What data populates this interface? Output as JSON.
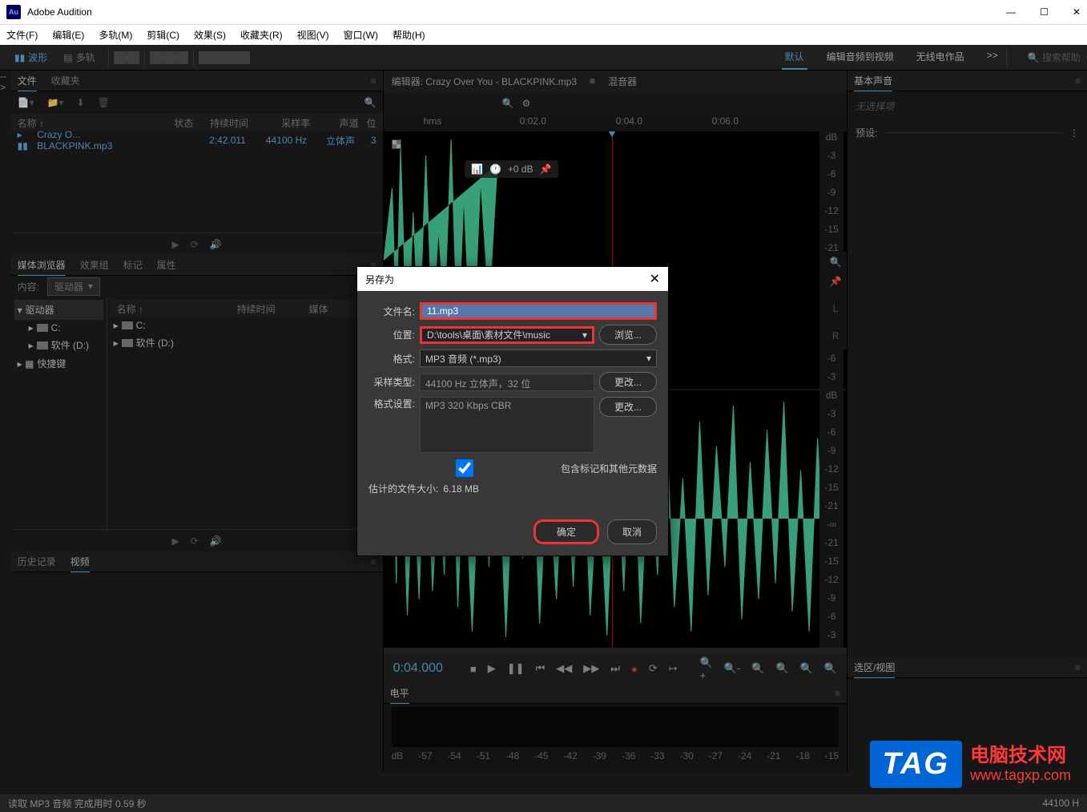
{
  "app": {
    "title": "Adobe Audition",
    "logo": "Au"
  },
  "menubar": [
    "文件(F)",
    "编辑(E)",
    "多轨(M)",
    "剪辑(C)",
    "效果(S)",
    "收藏夹(R)",
    "视图(V)",
    "窗口(W)",
    "帮助(H)"
  ],
  "toolbar": {
    "waveform": "波形",
    "multitrack": "多轨",
    "search_placeholder": "搜索帮助"
  },
  "workspaces": {
    "default": "默认",
    "edit_audio_video": "编辑音频到视频",
    "radio": "无线电作品",
    "more": ">>"
  },
  "panels": {
    "files_tab": "文件",
    "favorites_tab": "收藏夹",
    "media_browser_tab": "媒体浏览器",
    "effects_rack_tab": "效果组",
    "markers_tab": "标记",
    "properties_tab": "属性",
    "history_tab": "历史记录",
    "video_tab": "视频",
    "basic_sound_tab": "基本声音",
    "selection_view_tab": "选区/视图"
  },
  "file_panel": {
    "columns": {
      "name": "名称 ↑",
      "status": "状态",
      "duration": "持续时间",
      "sample_rate": "采样率",
      "channels": "声道",
      "bit": "位"
    },
    "row": {
      "name": "Crazy O... BLACKPINK.mp3",
      "duration": "2:42.011",
      "sample_rate": "44100 Hz",
      "channels": "立体声",
      "bit": "3"
    }
  },
  "media_browser": {
    "content_label": "内容:",
    "driver": "驱动器",
    "drives_header": "驱动器",
    "columns": {
      "name": "名称 ↑",
      "duration": "持续时间",
      "media": "媒体"
    },
    "items": [
      "C:",
      "软件 (D:)",
      "快捷键"
    ],
    "list_items": [
      "C:",
      "软件 (D:)"
    ]
  },
  "editor": {
    "title": "编辑器: Crazy Over You - BLACKPINK.mp3",
    "mixer": "混音器",
    "timeline": {
      "hms": "hms",
      "marks": [
        "0:02.0",
        "0:04.0",
        "0:06.0"
      ]
    },
    "db_label": "dB",
    "db_scale": [
      "-3",
      "-6",
      "-9",
      "-12",
      "-15",
      "-21",
      "-∞",
      "-21",
      "-15",
      "-12",
      "-9",
      "-6",
      "-3"
    ],
    "hud": "+0 dB",
    "stereo": {
      "l": "L",
      "r": "R"
    }
  },
  "transport": {
    "time": "0:04.000"
  },
  "levels": {
    "title": "电平",
    "scale": [
      "dB",
      "-57",
      "-54",
      "-51",
      "-48",
      "-45",
      "-42",
      "-39",
      "-36",
      "-33",
      "-30",
      "-27",
      "-24",
      "-21",
      "-18",
      "-15"
    ]
  },
  "right_panel": {
    "no_selection": "无选择项",
    "preset_label": "预设:"
  },
  "dialog": {
    "title": "另存为",
    "filename_label": "文件名:",
    "filename_value": "11.mp3",
    "location_label": "位置:",
    "location_value": "D:\\tools\\桌面\\素材文件\\music",
    "browse": "浏览...",
    "format_label": "格式:",
    "format_value": "MP3 音频 (*.mp3)",
    "sample_type_label": "采样类型:",
    "sample_type_value": "44100 Hz 立体声，32 位",
    "change1": "更改...",
    "format_settings_label": "格式设置:",
    "format_settings_value": "MP3 320 Kbps CBR",
    "change2": "更改...",
    "include_meta": "包含标记和其他元数据",
    "estimated_size_label": "估计的文件大小:",
    "estimated_size_value": "6.18 MB",
    "ok": "确定",
    "cancel": "取消"
  },
  "statusbar": {
    "left": "读取 MP3 音频 完成用时 0.59 秒",
    "right": "44100 H"
  },
  "watermark": {
    "tag": "TAG",
    "text": "电脑技术网",
    "url": "www.tagxp.com"
  }
}
